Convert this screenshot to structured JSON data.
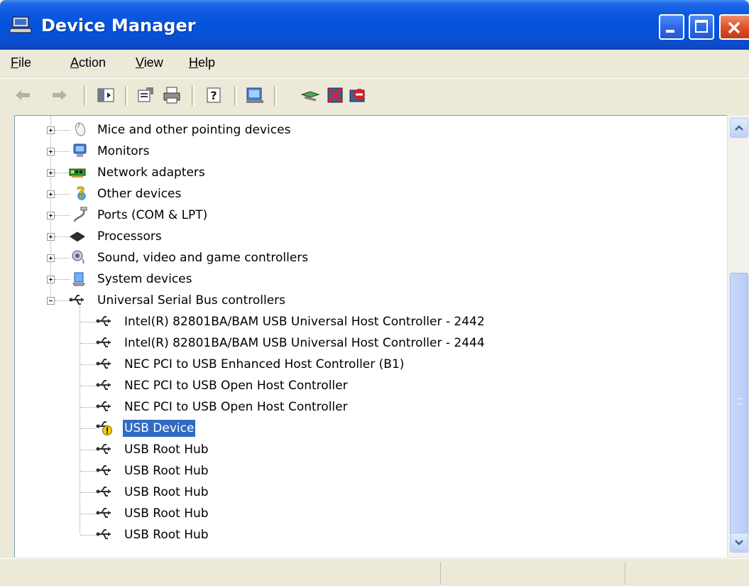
{
  "window": {
    "title": "Device Manager"
  },
  "menu": [
    {
      "label": "File",
      "accel": "F",
      "rest": "ile"
    },
    {
      "label": "Action",
      "accel": "A",
      "rest": "ction"
    },
    {
      "label": "View",
      "accel": "V",
      "rest": "iew"
    },
    {
      "label": "Help",
      "accel": "H",
      "rest": "elp"
    }
  ],
  "tree": {
    "categories": [
      {
        "label": "Mice and other pointing devices",
        "icon": "mouse-icon"
      },
      {
        "label": "Monitors",
        "icon": "monitor-icon"
      },
      {
        "label": "Network adapters",
        "icon": "network-card-icon"
      },
      {
        "label": "Other devices",
        "icon": "question-mark-icon"
      },
      {
        "label": "Ports (COM & LPT)",
        "icon": "port-cable-icon"
      },
      {
        "label": "Processors",
        "icon": "chip-icon"
      },
      {
        "label": "Sound, video and game controllers",
        "icon": "speaker-icon"
      },
      {
        "label": "System devices",
        "icon": "system-computer-icon"
      },
      {
        "label": "Universal Serial Bus controllers",
        "icon": "usb-icon"
      }
    ],
    "usb_children": [
      {
        "label": "Intel(R) 82801BA/BAM USB Universal Host Controller - 2442"
      },
      {
        "label": "Intel(R) 82801BA/BAM USB Universal Host Controller - 2444"
      },
      {
        "label": "NEC PCI to USB Enhanced Host Controller (B1)"
      },
      {
        "label": "NEC PCI to USB Open Host Controller"
      },
      {
        "label": "NEC PCI to USB Open Host Controller"
      },
      {
        "label": "USB Device",
        "selected": true,
        "warning": true
      },
      {
        "label": "USB Root Hub"
      },
      {
        "label": "USB Root Hub"
      },
      {
        "label": "USB Root Hub"
      },
      {
        "label": "USB Root Hub"
      },
      {
        "label": "USB Root Hub"
      }
    ]
  },
  "colors": {
    "selection": "#316ac5",
    "titlebar": "#0553da"
  }
}
